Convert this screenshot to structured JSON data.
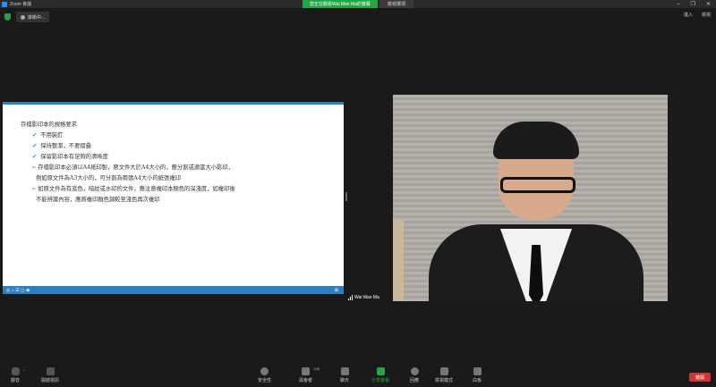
{
  "window": {
    "title": "Zoom 會議",
    "controls": [
      "–",
      "❐",
      "✕"
    ]
  },
  "share_banner": "您正在觀看Wai Man Ma的螢幕",
  "view_button": "檢視選項",
  "sharing_pill": "掛斷中...",
  "top_right": {
    "enter_label": "進入",
    "layout_label": "檢視"
  },
  "slide": {
    "title": "存檔影印本的規格要求",
    "checks": [
      "不用裝釘",
      "保持整潔，不要摺疊",
      "保留影印本有足夠的清晰度"
    ],
    "arrow1_line1": "存檔影印本必須以A4紙印製，原文件大於A4大小的，應分割或適當大小影印，",
    "arrow1_line2": "例如原文件為A3大小的，可分割為兩張A4大小的紙張複印",
    "arrow2_line1": "如原文件為有底色，暗紋或水印的文件，應注意複印本顏色的深淺度，如複印後",
    "arrow2_line2": "不能辨識內容，應將複印顏色調較至淺色再次複印",
    "footer_left": "◎ ⌂ ☰ ◻ ◀",
    "footer_right": "⊞"
  },
  "participant": {
    "name": "Wai Man Ma"
  },
  "toolbar": {
    "mute": "靜音",
    "video": "開啟視訊",
    "security": "安全性",
    "participants": "與會者",
    "participants_count": "188",
    "chat": "聊天",
    "share": "分享螢幕",
    "reactions": "回應",
    "view_mode": "檢視模式",
    "more": "白板",
    "end": "離開"
  },
  "colors": {
    "accent_blue": "#2b7fc3",
    "share_green": "#23a745",
    "end_red": "#d63232"
  }
}
